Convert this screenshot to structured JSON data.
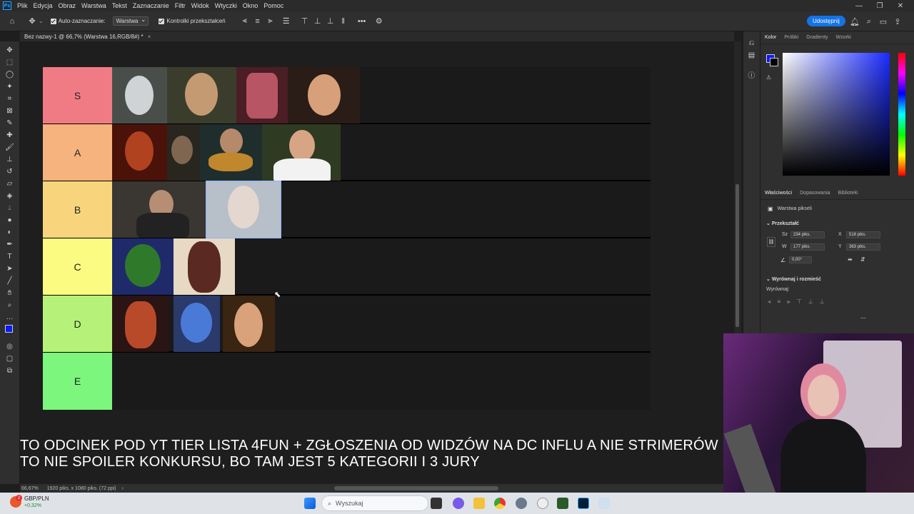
{
  "menubar": {
    "items": [
      "Plik",
      "Edycja",
      "Obraz",
      "Warstwa",
      "Tekst",
      "Zaznaczanie",
      "Filtr",
      "Widok",
      "Wtyczki",
      "Okno",
      "Pomoc"
    ],
    "app_logo": "Ps"
  },
  "options": {
    "auto_select_label": "Auto-zaznaczanie:",
    "auto_select_value": "Warstwa",
    "transform_controls_label": "Kontrolki przekształceń",
    "share_label": "Udostępnij"
  },
  "document": {
    "tab_title": "Bez nazwy-1 @ 66,7% (Warstwa 16,RGB/8#) *"
  },
  "tiers": [
    {
      "label": "S",
      "color": "#f07b85"
    },
    {
      "label": "A",
      "color": "#f6b37e"
    },
    {
      "label": "B",
      "color": "#f8d57d"
    },
    {
      "label": "C",
      "color": "#fbfb82"
    },
    {
      "label": "D",
      "color": "#b6f27a"
    },
    {
      "label": "E",
      "color": "#7cf67c"
    }
  ],
  "overlay": {
    "line1": "TO ODCINEK POD YT TIER LISTA 4FUN + ZGŁOSZENIA OD WIDZÓW NA DC INFLU A NIE STRIMERÓW",
    "line2": "TO NIE SPOILER KONKURSU, BO TAM JEST 5 KATEGORII I 3 JURY"
  },
  "color_panel": {
    "tabs": [
      "Kolor",
      "Próbki",
      "Gradienty",
      "Wzorki"
    ],
    "foreground": "#0a1aff",
    "background": "#000000"
  },
  "properties_panel": {
    "tabs": [
      "Właściwości",
      "Dopasowania",
      "Biblioteki"
    ],
    "layer_type": "Warstwa pikseli",
    "transform_label": "Przekształć",
    "w_label": "Sz",
    "w_value": "234 piks.",
    "h_label": "W",
    "h_value": "177 piks.",
    "x_label": "X",
    "x_value": "518 piks.",
    "y_label": "Y",
    "y_value": "363 piks.",
    "angle_value": "0,00°",
    "align_section": "Wyrównaj i rozmieść",
    "align_label": "Wyrównaj:",
    "more": "..."
  },
  "statusbar": {
    "zoom": "66,67%",
    "doc_info": "1920 piks. x 1080 piks. (72 ppi)"
  },
  "taskbar": {
    "widget_title": "GBP/PLN",
    "widget_value": "+0,32%",
    "widget_badge": "2",
    "search_placeholder": "Wyszukaj"
  }
}
